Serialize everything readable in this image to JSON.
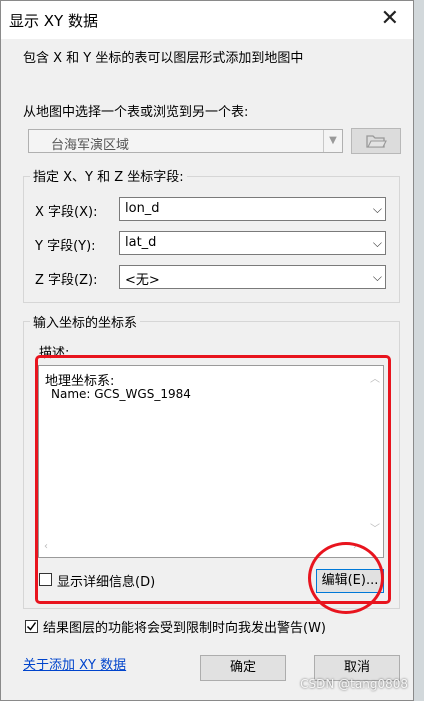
{
  "dialog": {
    "title": "显示 XY 数据",
    "close_glyph": "✕",
    "intro": "包含 X 和 Y 坐标的表可以图层形式添加到地图中",
    "table_prompt": "从地图中选择一个表或浏览到另一个表:",
    "table_value": "台海军演区域",
    "browse_icon": "folder-open-icon"
  },
  "fields": {
    "group_label": "指定 X、Y 和 Z 坐标字段:",
    "x_label": "X 字段(X):",
    "x_value": "lon_d",
    "y_label": "Y 字段(Y):",
    "y_value": "lat_d",
    "z_label": "Z 字段(Z):",
    "z_value": "<无>"
  },
  "crs": {
    "group_label": "输入坐标的坐标系",
    "desc_label": "描述:",
    "line1": "地理坐标系:",
    "line2": "Name: GCS_WGS_1984",
    "show_details": "显示详细信息(D)",
    "edit_button": "编辑(E)..."
  },
  "footer": {
    "warn_label": "结果图层的功能将会受到限制时向我发出警告(W)",
    "warn_checked": true,
    "about_link": "关于添加 XY 数据",
    "ok_button": "确定",
    "cancel_button": "取消"
  },
  "watermark": "CSDN @tang0808",
  "colors": {
    "annotation_red": "#e8141e",
    "link_blue": "#0044cc"
  }
}
